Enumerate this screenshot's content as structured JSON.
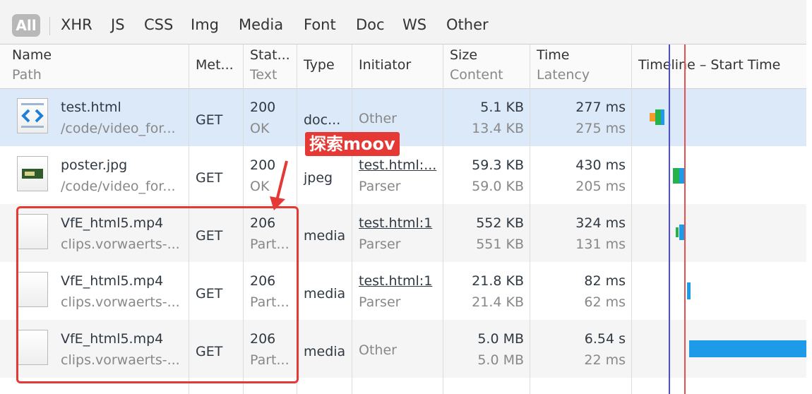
{
  "filters": [
    "All",
    "XHR",
    "JS",
    "CSS",
    "Img",
    "Media",
    "Font",
    "Doc",
    "WS",
    "Other"
  ],
  "headers": {
    "name": [
      "Name",
      "Path"
    ],
    "method": "Met...",
    "status": [
      "Stat...",
      "Text"
    ],
    "type": "Type",
    "initiator": "Initiator",
    "size": [
      "Size",
      "Content"
    ],
    "time": [
      "Time",
      "Latency"
    ],
    "timeline": "Timeline – Start Time"
  },
  "rows": [
    {
      "name": "test.html",
      "path": "/code/video_for...",
      "method": "GET",
      "status": "200",
      "status_text": "OK",
      "type": "doc...",
      "initiator": "Other",
      "initiator_sub": "",
      "size": "5.1 KB",
      "content": "13.4 KB",
      "time": "277 ms",
      "latency": "275 ms",
      "icon": "html-file-icon",
      "selected": true
    },
    {
      "name": "poster.jpg",
      "path": "/code/video_for...",
      "method": "GET",
      "status": "200",
      "status_text": "OK",
      "type": "jpeg",
      "initiator": "test.html:...",
      "initiator_sub": "Parser",
      "size": "59.3 KB",
      "content": "59.0 KB",
      "time": "430 ms",
      "latency": "205 ms",
      "icon": "image-file-icon",
      "selected": false
    },
    {
      "name": "VfE_html5.mp4",
      "path": "clips.vorwaerts-...",
      "method": "GET",
      "status": "206",
      "status_text": "Part...",
      "type": "media",
      "initiator": "test.html:1",
      "initiator_sub": "Parser",
      "size": "552 KB",
      "content": "551 KB",
      "time": "324 ms",
      "latency": "131 ms",
      "icon": "media-file-icon",
      "selected": false
    },
    {
      "name": "VfE_html5.mp4",
      "path": "clips.vorwaerts-...",
      "method": "GET",
      "status": "206",
      "status_text": "Part...",
      "type": "media",
      "initiator": "test.html:1",
      "initiator_sub": "Parser",
      "size": "21.8 KB",
      "content": "21.4 KB",
      "time": "82 ms",
      "latency": "62 ms",
      "icon": "media-file-icon",
      "selected": false
    },
    {
      "name": "VfE_html5.mp4",
      "path": "clips.vorwaerts-...",
      "method": "GET",
      "status": "206",
      "status_text": "Part...",
      "type": "media",
      "initiator": "Other",
      "initiator_sub": "",
      "size": "5.0 MB",
      "content": "5.0 MB",
      "time": "6.54 s",
      "latency": "22 ms",
      "icon": "media-file-icon",
      "selected": false
    }
  ],
  "annotation": {
    "label": "探索moov",
    "color": "#e53935"
  },
  "colors": {
    "selected_row": "#dce9f9",
    "alt_row": "#f5f5f5",
    "bar_wait": "#26b24b",
    "bar_receive": "#1e9be8",
    "bar_stalled": "#f59b2b",
    "domcontent_line": "#4b4be8",
    "load_line": "#e85050"
  }
}
